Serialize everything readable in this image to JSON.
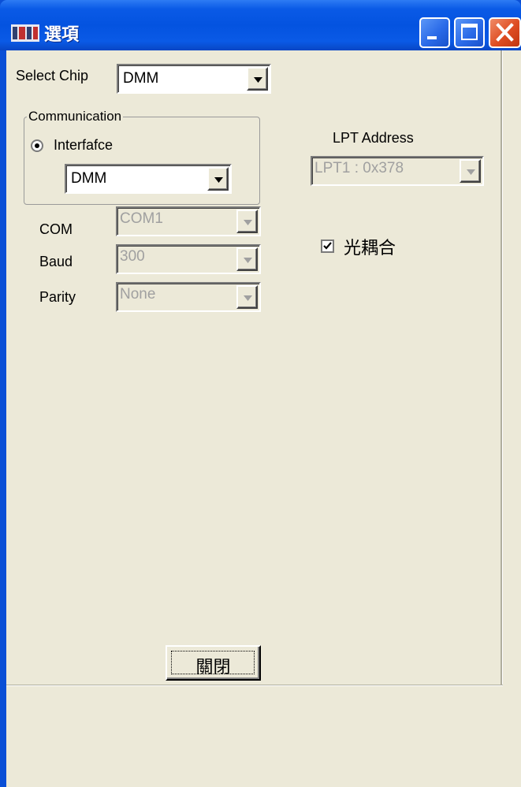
{
  "window": {
    "title": "選項",
    "colors": {
      "titlebar": "#0453e0",
      "client": "#ece9d8",
      "close_button": "#de4d22"
    }
  },
  "titlebar_buttons": {
    "minimize_icon": "minimize-icon",
    "maximize_icon": "maximize-icon",
    "close_icon": "close-icon"
  },
  "select_chip": {
    "label": "Select Chip",
    "value": "DMM"
  },
  "communication": {
    "group_title": "Communication",
    "radio_label": "Interfafce",
    "interface_value": "DMM"
  },
  "serial": {
    "com": {
      "label": "COM",
      "value": "COM1"
    },
    "baud": {
      "label": "Baud",
      "value": "300"
    },
    "parity": {
      "label": "Parity",
      "value": "None"
    }
  },
  "lpt": {
    "label": "LPT Address",
    "value": "LPT1 : 0x378"
  },
  "optocoupler": {
    "label": "光耦合",
    "checked": true
  },
  "close_button": {
    "label": "關閉"
  }
}
